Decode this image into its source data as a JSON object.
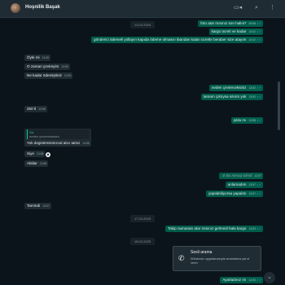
{
  "header": {
    "contact_name": "Hoşnilik Başak",
    "video_icon": "video-call-icon",
    "search_icon": "search-icon",
    "menu_icon": "more-menu-icon"
  },
  "dates": [
    "13.03.2025",
    "17.03.2025",
    "18.03.2025"
  ],
  "messages": [
    {
      "dir": "out",
      "text": "foto atar mısınız son halini?",
      "time": "09:58"
    },
    {
      "dir": "out",
      "text": "kargo ücreti ve kadar",
      "time": "10:02"
    },
    {
      "dir": "out",
      "text": "gönderici ödemeli yollayın kapıda ödeme olmasın ibarıdan kalan ücretle beraber size atayım",
      "time": "10:02"
    },
    {
      "dir": "in",
      "text": "Öyle mi",
      "time": "13:49"
    },
    {
      "dir": "in",
      "text": "O zaman çevireyim",
      "time": "13:50"
    },
    {
      "dir": "in",
      "text": "Ne kadar ödemiştiniz",
      "time": "13:50"
    },
    {
      "dir": "out",
      "text": "neden çevireceksiniz",
      "time": "13:52"
    },
    {
      "dir": "out",
      "text": "tamam çıktıysa sıkıntı yok",
      "time": "13:52"
    },
    {
      "dir": "in",
      "text": "250 tl",
      "time": "13:58"
    },
    {
      "dir": "out",
      "text": "şıkla mı",
      "time": "13:58"
    },
    {
      "dir": "in",
      "text": "Yok degistirmisinizcal alıcı tatlıci",
      "time": "13:58",
      "quote_name": "Siz",
      "quote_text": "neden çevireceksiniz"
    },
    {
      "dir": "in",
      "text": "Siye",
      "time": "13:58"
    },
    {
      "dir": "in",
      "text": "Aktilar",
      "time": "13:58"
    },
    {
      "dir": "out",
      "text": "Bu mesaj silindi",
      "time": "13:57",
      "deleted": true
    },
    {
      "dir": "out",
      "text": "anlamadım",
      "time": "13:57"
    },
    {
      "dir": "out",
      "text": "yapılabiliyorsa yapalım",
      "time": "13:57"
    },
    {
      "dir": "in",
      "text": "Tammdi",
      "time": "13:57"
    },
    {
      "dir": "out",
      "text": "Takip numarası atar mısınız gelmedi hala kargo",
      "time": "14:53"
    },
    {
      "dir": "out",
      "text": "Ayarladınız mı",
      "time": "14:53"
    }
  ],
  "reaction": "☻",
  "check_mark": "✓✓",
  "toast": {
    "title": "Sesli arama",
    "body": "Windows uygulamasıyla aramalara yanıt verin",
    "icon": "phone-icon"
  },
  "down_icon": "chevron-down-icon",
  "colors": {
    "background": "#0b141a",
    "incoming_bubble": "#202c33",
    "outgoing_bubble": "#005c4b",
    "header": "#202c33"
  }
}
